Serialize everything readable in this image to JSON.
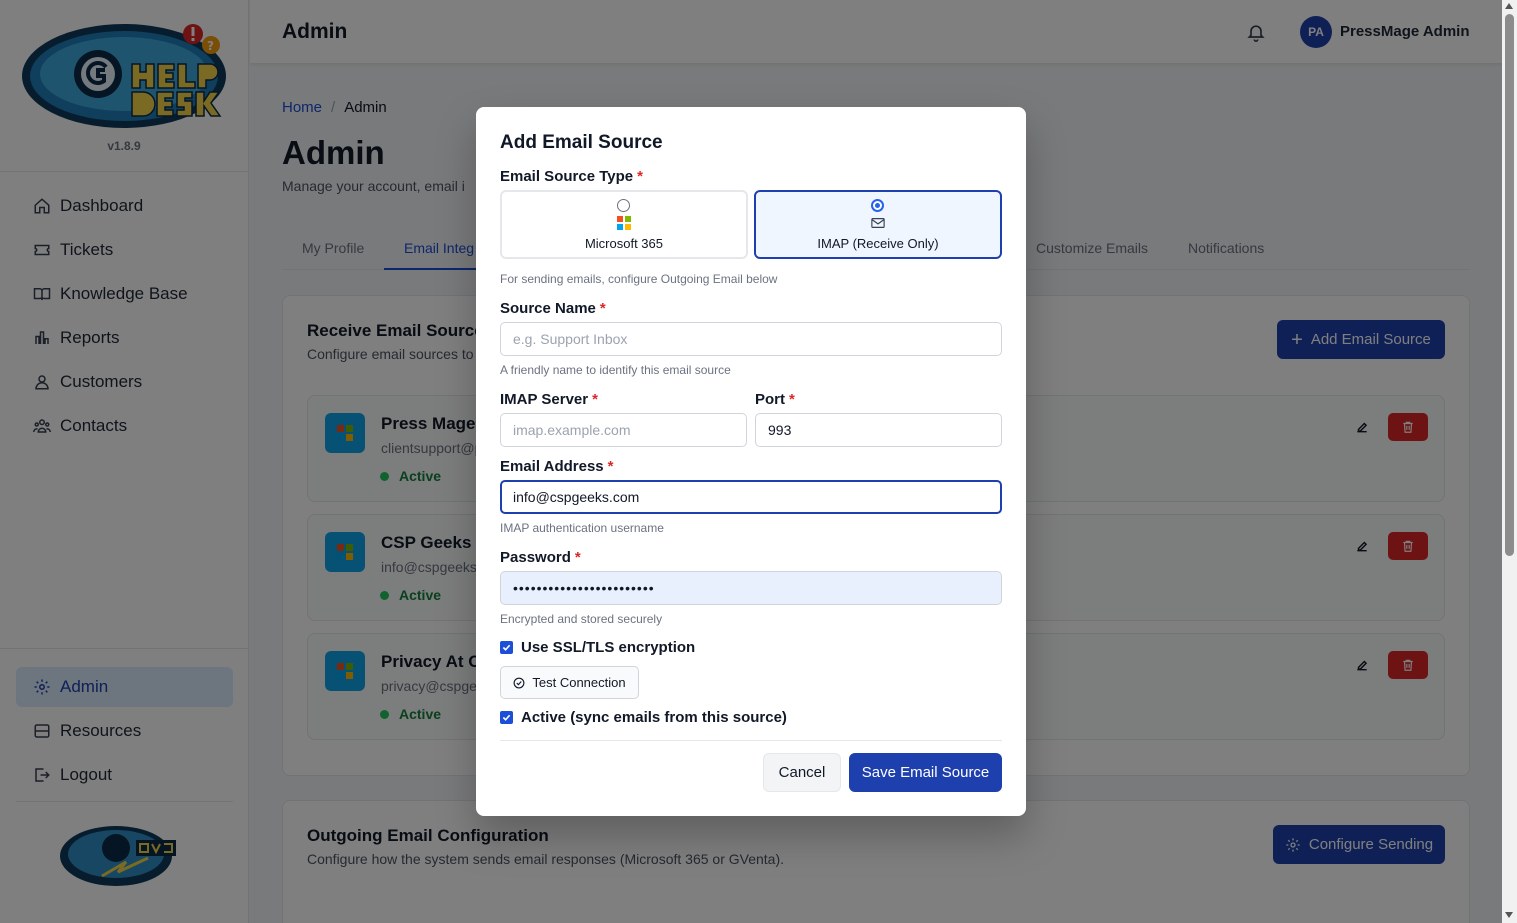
{
  "sidebar": {
    "version": "v1.8.9",
    "items": [
      {
        "label": "Dashboard",
        "icon": "home-icon"
      },
      {
        "label": "Tickets",
        "icon": "ticket-icon"
      },
      {
        "label": "Knowledge Base",
        "icon": "book-icon"
      },
      {
        "label": "Reports",
        "icon": "chart-icon"
      },
      {
        "label": "Customers",
        "icon": "users-icon"
      },
      {
        "label": "Contacts",
        "icon": "contacts-icon"
      }
    ],
    "bottom_items": [
      {
        "label": "Admin",
        "icon": "gear-icon",
        "active": true
      },
      {
        "label": "Resources",
        "icon": "archive-icon"
      },
      {
        "label": "Logout",
        "icon": "logout-icon"
      }
    ]
  },
  "header": {
    "title": "Admin",
    "avatar_initials": "PA",
    "username": "PressMage Admin"
  },
  "main": {
    "breadcrumb": {
      "home": "Home",
      "separator": "/",
      "current": "Admin"
    },
    "title": "Admin",
    "subtitle": "Manage your account, email i",
    "tabs": [
      {
        "label": "My Profile"
      },
      {
        "label": "Email Integ",
        "active": true
      },
      {
        "label": "Customize Emails"
      },
      {
        "label": "Notifications"
      }
    ],
    "receive_card": {
      "title": "Receive Email Sources",
      "subtitle": "Configure email sources to",
      "add_button": "Add Email Source",
      "sources": [
        {
          "name": "Press Mage S",
          "email": "clientsupport@p",
          "status": "Active"
        },
        {
          "name": "CSP Geeks In",
          "email": "info@cspgeeks",
          "status": "Active"
        },
        {
          "name": "Privacy At CS",
          "email": "privacy@cspge",
          "status": "Active"
        }
      ]
    },
    "outgoing_card": {
      "title": "Outgoing Email Configuration",
      "subtitle": "Configure how the system sends email responses (Microsoft 365 or GVenta).",
      "button": "Configure Sending"
    }
  },
  "modal": {
    "title": "Add Email Source",
    "type_label": "Email Source Type",
    "required_mark": "*",
    "type_options": [
      {
        "label": "Microsoft 365",
        "selected": false
      },
      {
        "label": "IMAP (Receive Only)",
        "selected": true
      }
    ],
    "type_help": "For sending emails, configure Outgoing Email below",
    "source_name": {
      "label": "Source Name",
      "placeholder": "e.g. Support Inbox",
      "value": "",
      "help": "A friendly name to identify this email source"
    },
    "imap_server": {
      "label": "IMAP Server",
      "placeholder": "imap.example.com",
      "value": ""
    },
    "port": {
      "label": "Port",
      "value": "993"
    },
    "email_address": {
      "label": "Email Address",
      "value": "info@cspgeeks.com",
      "help": "IMAP authentication username"
    },
    "password": {
      "label": "Password",
      "value": "••••••••••••••••••••••••",
      "help": "Encrypted and stored securely"
    },
    "ssl": {
      "label": "Use SSL/TLS encryption",
      "checked": true
    },
    "test_button": "Test Connection",
    "active": {
      "label": "Active (sync emails from this source)",
      "checked": true
    },
    "cancel": "Cancel",
    "save": "Save Email Source"
  },
  "colors": {
    "primary": "#1e40af",
    "danger": "#dc2626",
    "success": "#15803d",
    "overlay": "rgba(0,0,0,0.5)"
  }
}
